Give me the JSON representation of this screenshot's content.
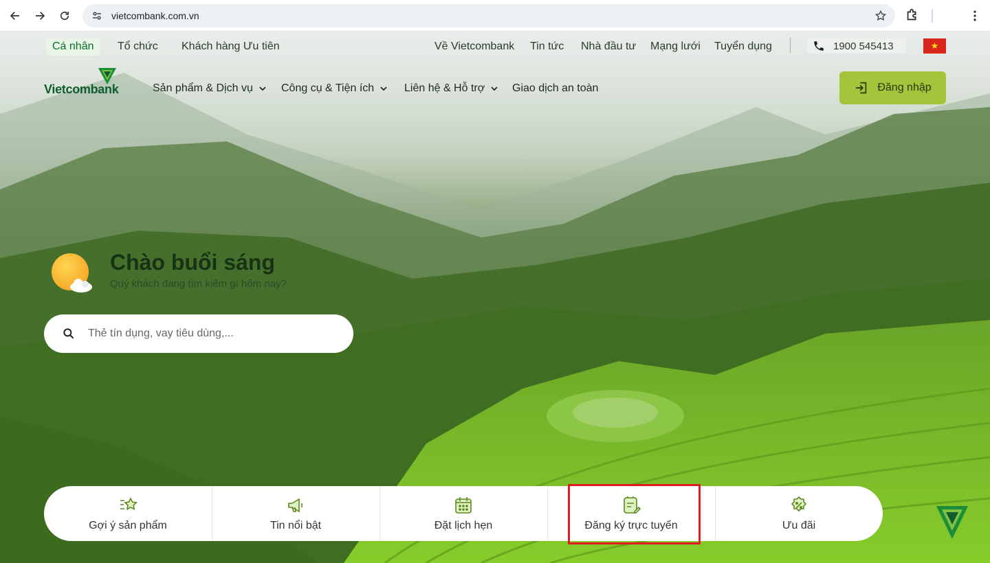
{
  "browser": {
    "url": "vietcombank.com.vn"
  },
  "topbar": {
    "segments": [
      "Cá nhân",
      "Tổ chức",
      "Khách hàng Ưu tiên"
    ],
    "links": [
      "Về Vietcombank",
      "Tin tức",
      "Nhà đầu tư",
      "Mạng lưới",
      "Tuyển dụng"
    ],
    "phone": "1900 545413",
    "flag_icon": "vietnam-flag-icon"
  },
  "brand": {
    "name": "Vietcombank",
    "color": "#0f5c2d"
  },
  "nav": {
    "items": [
      "Sản phẩm & Dịch vụ",
      "Công cụ & Tiện ích",
      "Liên hệ & Hỗ trợ",
      "Giao dịch an toàn"
    ],
    "login": "Đăng nhập",
    "login_color": "#a6c43b"
  },
  "greeting": {
    "title": "Chào buổi sáng",
    "subtitle": "Quý khách đang tìm kiếm gì hôm nay?"
  },
  "search": {
    "placeholder": "Thẻ tín dụng, vay tiêu dùng,..."
  },
  "quick_actions": [
    {
      "label": "Gợi ý sản phẩm",
      "icon": "star-list-icon"
    },
    {
      "label": "Tin nổi bật",
      "icon": "megaphone-icon"
    },
    {
      "label": "Đặt lịch hẹn",
      "icon": "calendar-icon"
    },
    {
      "label": "Đăng ký trực tuyến",
      "icon": "edit-document-icon"
    },
    {
      "label": "Ưu đãi",
      "icon": "discount-badge-icon"
    }
  ],
  "highlight_color": "#e21b23"
}
